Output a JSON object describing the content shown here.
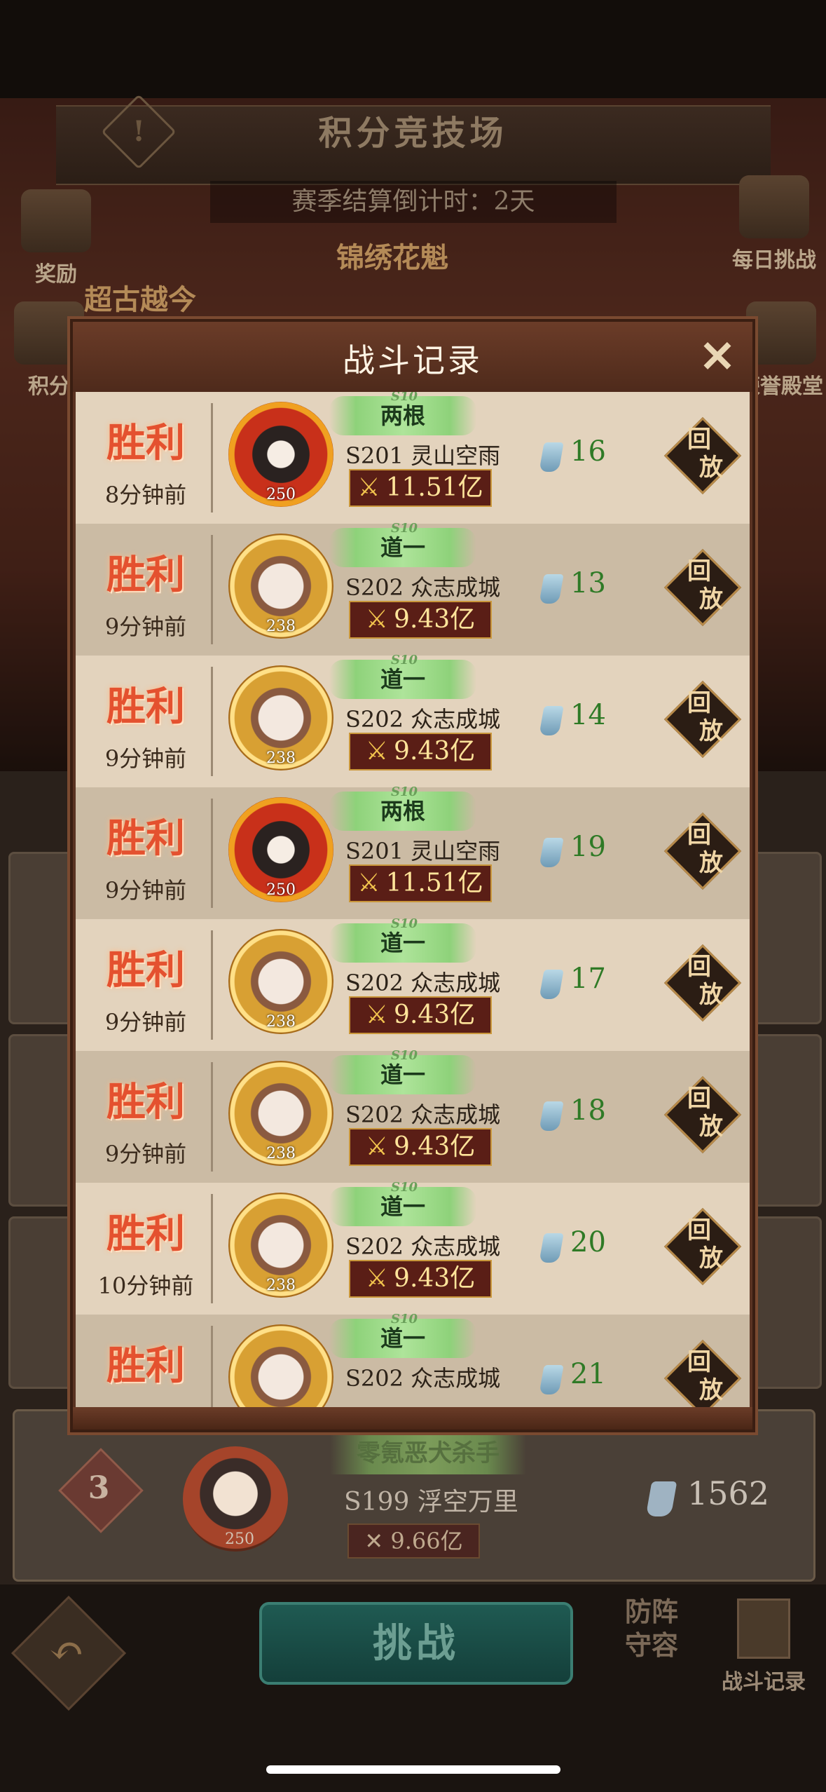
{
  "page": {
    "title": "积分竞技场",
    "countdown": "赛季结算倒计时：2天",
    "left_buttons": [
      "奖励",
      "积分"
    ],
    "right_buttons": [
      "每日挑战",
      "荣誉殿堂"
    ],
    "faded_tags": [
      "锦绣花魁",
      "超古越今"
    ]
  },
  "modal": {
    "title": "战斗记录",
    "close_icon": "close-x-icon",
    "records": [
      {
        "result": "胜利",
        "time": "8分钟前",
        "avatar_style": "red",
        "level": "250",
        "nickname": "两根",
        "server": "S201 灵山空雨",
        "power": "11.51亿",
        "score": "16",
        "replay": [
          "回",
          "放"
        ]
      },
      {
        "result": "胜利",
        "time": "9分钟前",
        "avatar_style": "gold",
        "level": "238",
        "nickname": "道一",
        "server": "S202 众志成城",
        "power": "9.43亿",
        "score": "13",
        "replay": [
          "回",
          "放"
        ]
      },
      {
        "result": "胜利",
        "time": "9分钟前",
        "avatar_style": "gold",
        "level": "238",
        "nickname": "道一",
        "server": "S202 众志成城",
        "power": "9.43亿",
        "score": "14",
        "replay": [
          "回",
          "放"
        ]
      },
      {
        "result": "胜利",
        "time": "9分钟前",
        "avatar_style": "red",
        "level": "250",
        "nickname": "两根",
        "server": "S201 灵山空雨",
        "power": "11.51亿",
        "score": "19",
        "replay": [
          "回",
          "放"
        ]
      },
      {
        "result": "胜利",
        "time": "9分钟前",
        "avatar_style": "gold",
        "level": "238",
        "nickname": "道一",
        "server": "S202 众志成城",
        "power": "9.43亿",
        "score": "17",
        "replay": [
          "回",
          "放"
        ]
      },
      {
        "result": "胜利",
        "time": "9分钟前",
        "avatar_style": "gold",
        "level": "238",
        "nickname": "道一",
        "server": "S202 众志成城",
        "power": "9.43亿",
        "score": "18",
        "replay": [
          "回",
          "放"
        ]
      },
      {
        "result": "胜利",
        "time": "10分钟前",
        "avatar_style": "gold",
        "level": "238",
        "nickname": "道一",
        "server": "S202 众志成城",
        "power": "9.43亿",
        "score": "20",
        "replay": [
          "回",
          "放"
        ]
      },
      {
        "result": "胜利",
        "time": "",
        "avatar_style": "gold",
        "level": "",
        "nickname": "道一",
        "server": "S202 众志成城",
        "power": "",
        "score": "21",
        "replay": [
          "回",
          "放"
        ]
      }
    ]
  },
  "rank_row": {
    "rank": "3",
    "level": "250",
    "title": "零氪恶犬杀手",
    "server": "S199 浮空万里",
    "power": "9.66亿",
    "score": "1562"
  },
  "bottom": {
    "challenge": "挑战",
    "defense": [
      "防",
      "阵",
      "守",
      "容"
    ],
    "records_label": "战斗记录"
  },
  "colors": {
    "win_red": "#e4512f",
    "score_green": "#2f7a26",
    "power_bg": "#5a1e16"
  }
}
